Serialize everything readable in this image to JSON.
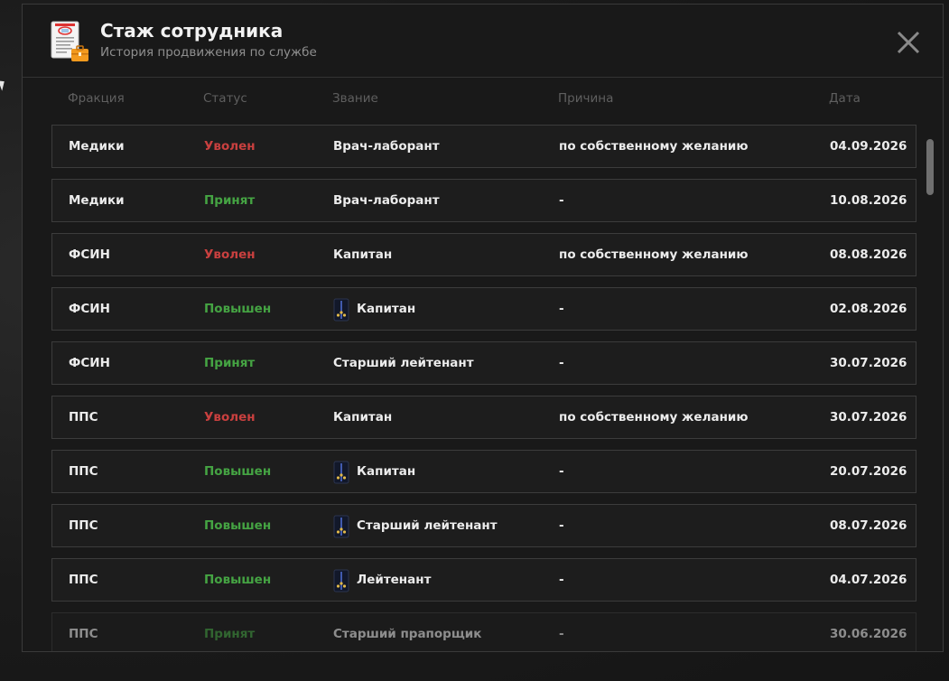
{
  "header": {
    "title": "Стаж сотрудника",
    "subtitle": "История продвижения по службе"
  },
  "columns": {
    "faction": "Фракция",
    "status": "Статус",
    "rank": "Звание",
    "reason": "Причина",
    "date": "Дата"
  },
  "colors": {
    "fired": "#c9403f",
    "hired": "#45a443",
    "promoted": "#45a443"
  },
  "rows": [
    {
      "faction": "Медики",
      "status": "Уволен",
      "status_type": "fired",
      "rank": "Врач-лаборант",
      "rank_icon": "",
      "reason": "по собственному желанию",
      "date": "04.09.2026"
    },
    {
      "faction": "Медики",
      "status": "Принят",
      "status_type": "hired",
      "rank": "Врач-лаборант",
      "rank_icon": "",
      "reason": "-",
      "date": "10.08.2026"
    },
    {
      "faction": "ФСИН",
      "status": "Уволен",
      "status_type": "fired",
      "rank": "Капитан",
      "rank_icon": "",
      "reason": "по собственному желанию",
      "date": "08.08.2026"
    },
    {
      "faction": "ФСИН",
      "status": "Повышен",
      "status_type": "promoted",
      "rank": "Капитан",
      "rank_icon": "shoulder-strap-icon",
      "reason": "-",
      "date": "02.08.2026"
    },
    {
      "faction": "ФСИН",
      "status": "Принят",
      "status_type": "hired",
      "rank": "Старший лейтенант",
      "rank_icon": "",
      "reason": "-",
      "date": "30.07.2026"
    },
    {
      "faction": "ППС",
      "status": "Уволен",
      "status_type": "fired",
      "rank": "Капитан",
      "rank_icon": "",
      "reason": "по собственному желанию",
      "date": "30.07.2026"
    },
    {
      "faction": "ППС",
      "status": "Повышен",
      "status_type": "promoted",
      "rank": "Капитан",
      "rank_icon": "shoulder-strap-icon",
      "reason": "-",
      "date": "20.07.2026"
    },
    {
      "faction": "ППС",
      "status": "Повышен",
      "status_type": "promoted",
      "rank": "Старший лейтенант",
      "rank_icon": "shoulder-strap-icon",
      "reason": "-",
      "date": "08.07.2026"
    },
    {
      "faction": "ППС",
      "status": "Повышен",
      "status_type": "promoted",
      "rank": "Лейтенант",
      "rank_icon": "shoulder-strap-icon",
      "reason": "-",
      "date": "04.07.2026"
    },
    {
      "faction": "ППС",
      "status": "Принят",
      "status_type": "hired",
      "rank": "Старший прапорщик",
      "rank_icon": "",
      "reason": "-",
      "date": "30.06.2026"
    }
  ],
  "icons": {
    "header": "employee-record-icon",
    "close": "close-icon"
  }
}
